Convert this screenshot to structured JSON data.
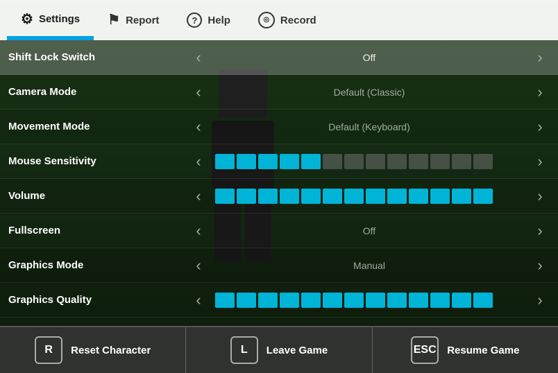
{
  "nav": {
    "tabs": [
      {
        "id": "settings",
        "label": "Settings",
        "icon": "⚙",
        "active": true
      },
      {
        "id": "report",
        "label": "Report",
        "icon": "⚑",
        "active": false
      },
      {
        "id": "help",
        "label": "Help",
        "icon": "?",
        "active": false
      },
      {
        "id": "record",
        "label": "Record",
        "icon": "◎",
        "active": false
      }
    ]
  },
  "settings": {
    "rows": [
      {
        "id": "shift-lock",
        "label": "Shift Lock Switch",
        "type": "option",
        "value": "Off"
      },
      {
        "id": "camera-mode",
        "label": "Camera Mode",
        "type": "option",
        "value": "Default (Classic)"
      },
      {
        "id": "movement-mode",
        "label": "Movement Mode",
        "type": "option",
        "value": "Default (Keyboard)"
      },
      {
        "id": "mouse-sensitivity",
        "label": "Mouse Sensitivity",
        "type": "slider",
        "active": 5,
        "total": 13
      },
      {
        "id": "volume",
        "label": "Volume",
        "type": "slider",
        "active": 13,
        "total": 13
      },
      {
        "id": "fullscreen",
        "label": "Fullscreen",
        "type": "option",
        "value": "Off"
      },
      {
        "id": "graphics-mode",
        "label": "Graphics Mode",
        "type": "option",
        "value": "Manual"
      },
      {
        "id": "graphics-quality",
        "label": "Graphics Quality",
        "type": "slider",
        "active": 13,
        "total": 13
      }
    ]
  },
  "bottom_bar": {
    "actions": [
      {
        "id": "reset",
        "key": "R",
        "label": "Reset Character"
      },
      {
        "id": "leave",
        "key": "L",
        "label": "Leave Game"
      },
      {
        "id": "resume",
        "key": "ESC",
        "label": "Resume Game"
      }
    ]
  }
}
